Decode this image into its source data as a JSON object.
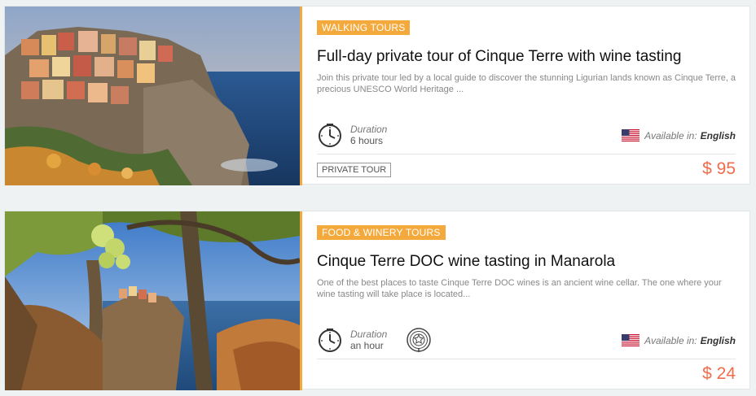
{
  "tours": [
    {
      "category": "WALKING TOURS",
      "title": "Full-day private tour of Cinque Terre with wine tasting",
      "description": "Join this private tour led by a local guide to discover the stunning Ligurian lands known as Cinque Terre, a precious UNESCO World Heritage ...",
      "duration_label": "Duration",
      "duration_value": "6 hours",
      "available_label": "Available in:",
      "language": "English",
      "tour_type": "PRIVATE TOUR",
      "price": "$ 95"
    },
    {
      "category": "FOOD & WINERY TOURS",
      "title": "Cinque Terre DOC wine tasting in Manarola",
      "description": "One of the best places to taste Cinque Terre DOC wines is an ancient wine cellar. The one where your wine tasting will take place is located...",
      "duration_label": "Duration",
      "duration_value": "an hour",
      "available_label": "Available in:",
      "language": "English",
      "price": "$ 24"
    }
  ],
  "icons": {
    "duration": "clock-icon",
    "feature": "wine-tasting-icon",
    "language": "us-flag-icon"
  },
  "colors": {
    "accent": "#f3a93c",
    "price": "#f26b4b"
  }
}
